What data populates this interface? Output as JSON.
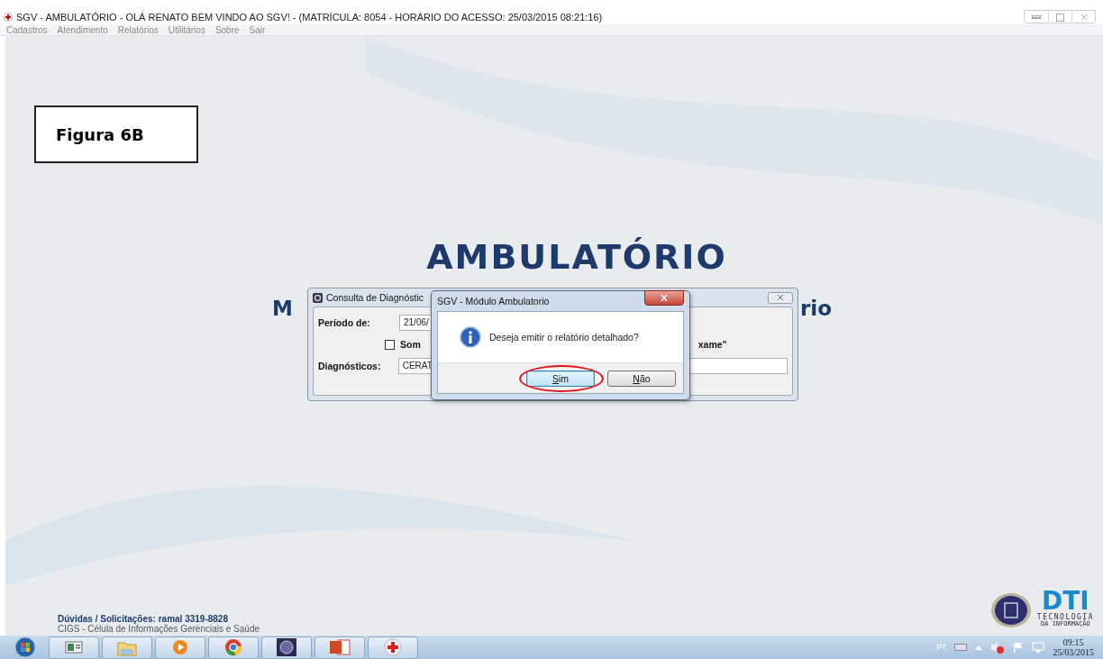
{
  "window": {
    "title": "SGV - AMBULATÓRIO - OLÁ RENATO BEM VINDO AO SGV! - (MATRÍCULA: 8054 - HORÁRIO DO ACESSO: 25/03/2015 08:21:16)"
  },
  "menu": [
    "Cadastros",
    "Atendimento",
    "Relatórios",
    "Utilitários",
    "Sobre",
    "Sair"
  ],
  "annotation": {
    "label": "Figura 6B"
  },
  "heading": "AMBULATÓRIO",
  "subtitle_left": "M",
  "subtitle_right": "rio",
  "query_dialog": {
    "title": "Consulta de Diagnóstic",
    "period_label": "Período de:",
    "period_value": "21/06/",
    "checkbox": {
      "label": "Som",
      "checked": false
    },
    "option_tail": "xame\"",
    "diagnoses_label": "Diagnósticos:",
    "diagnoses_value": "CERAT"
  },
  "message_box": {
    "title": "SGV - Módulo Ambulatorio",
    "message": "Deseja emitir o relatório detalhado?",
    "buttons": [
      {
        "label": "Sim",
        "selected": true,
        "circled": true
      },
      {
        "label": "Não",
        "selected": false,
        "circled": false
      }
    ]
  },
  "footer": {
    "contact": "Dúvidas / Solicitações: ramal 3319-8828",
    "org": "CIGS - Célula de Informações Gerenciais e Saúde"
  },
  "dti_logo": {
    "name": "DTI",
    "line1": "TECNOLOGIA",
    "line2": "DA INFORMAÇÃO"
  },
  "taskbar": {
    "apps": [
      {
        "kind": "window"
      },
      {
        "kind": "folder"
      },
      {
        "kind": "player"
      },
      {
        "kind": "browser"
      },
      {
        "kind": "seal"
      },
      {
        "kind": "slides"
      },
      {
        "kind": "cross"
      }
    ],
    "language": "PT",
    "time": "09:15",
    "date": "25/03/2015"
  }
}
